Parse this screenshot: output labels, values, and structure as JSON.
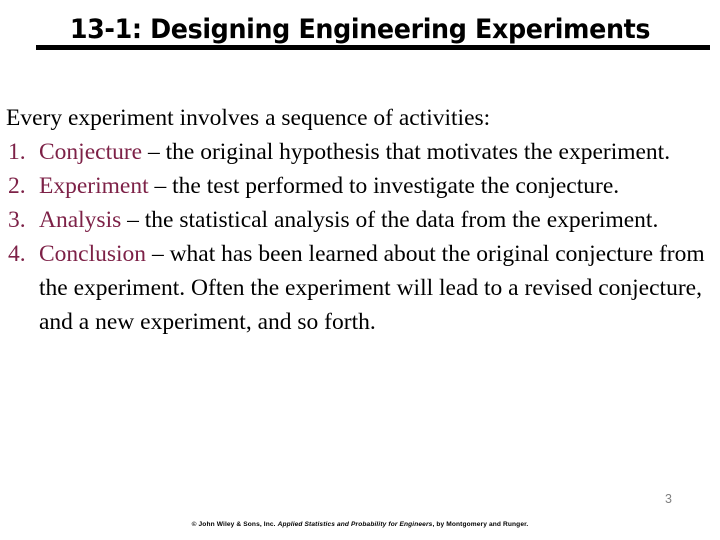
{
  "slide": {
    "title": "13-1: Designing Engineering Experiments",
    "intro": "Every experiment involves a sequence of activities:",
    "steps": [
      {
        "number": "1.",
        "keyword": "Conjecture",
        "rest": " – the original hypothesis that motivates the experiment."
      },
      {
        "number": "2.",
        "keyword": "Experiment",
        "rest": " – the test performed to investigate the conjecture."
      },
      {
        "number": "3.",
        "keyword": "Analysis",
        "rest": " – the statistical analysis of the data from the experiment."
      },
      {
        "number": "4.",
        "keyword": "Conclusion",
        "rest": " – what has been learned about the original conjecture from the experiment.  Often the experiment will lead to a revised conjecture, and a new experiment, and so forth."
      }
    ],
    "page_number": "3",
    "credit": {
      "prefix": "© John Wiley & Sons, Inc. ",
      "work_title": "Applied Statistics and Probability for Engineers",
      "suffix": ", by Montgomery and Runger."
    },
    "colors": {
      "keyword_maroon": "#7d2147",
      "body_text": "#000000",
      "title_text": "#000000",
      "page_number_gray": "#808080",
      "background": "#ffffff",
      "rule": "#000000"
    }
  }
}
